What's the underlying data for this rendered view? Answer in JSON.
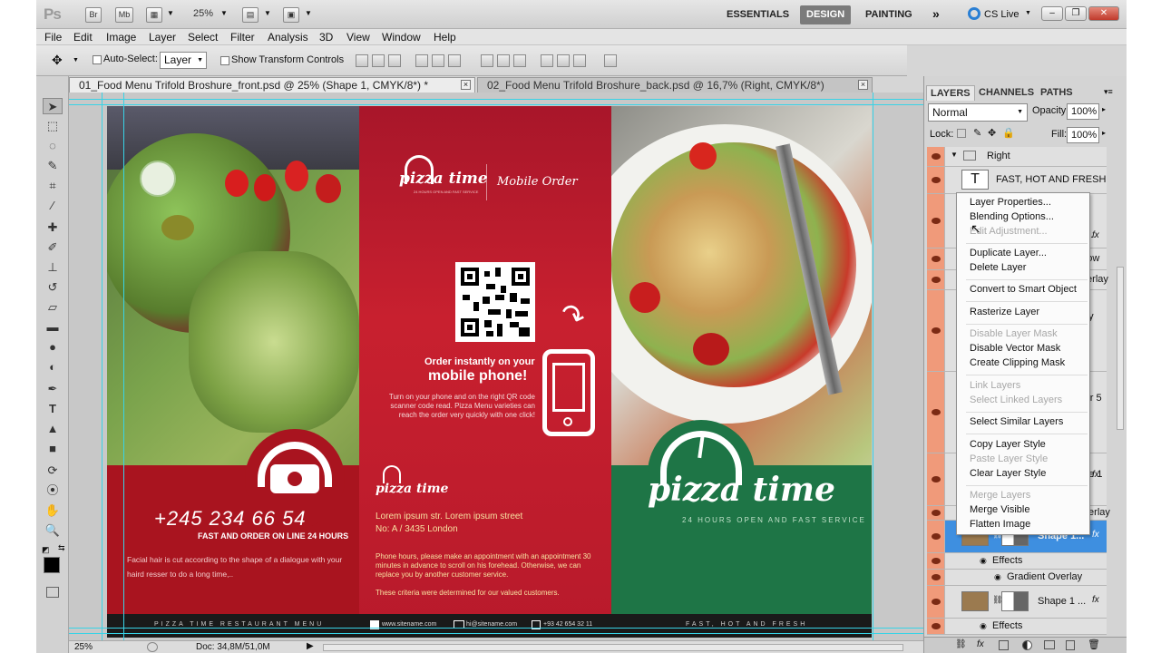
{
  "app_bar": {
    "logo": "Ps",
    "bridge_btn": "Br",
    "mini_bridge_btn": "Mb",
    "zoom": "25%",
    "workspaces": [
      "ESSENTIALS",
      "DESIGN",
      "PAINTING"
    ],
    "active_workspace": "DESIGN",
    "more": "»",
    "cs_live": "CS Live",
    "window_buttons": [
      "–",
      "❐",
      "✕"
    ]
  },
  "menu": [
    "File",
    "Edit",
    "Image",
    "Layer",
    "Select",
    "Filter",
    "Analysis",
    "3D",
    "View",
    "Window",
    "Help"
  ],
  "options": {
    "auto_select_label": "Auto-Select:",
    "auto_select_value": "Layer",
    "show_transform_label": "Show Transform Controls"
  },
  "tabs": [
    {
      "label": "01_Food Menu Trifold Broshure_front.psd @ 25% (Shape 1, CMYK/8*) *",
      "close": "×"
    },
    {
      "label": "02_Food Menu Trifold Broshure_back.psd @ 16,7% (Right, CMYK/8*)",
      "close": "×"
    }
  ],
  "brochure": {
    "panel1": {
      "phone": "+245 234 66 54",
      "subtitle": "FAST AND ORDER ON LINE 24 HOURS",
      "body": "Facial hair is cut according to the shape of a dialogue with your haird resser to do a long time,..",
      "footer": "PIZZA TIME RESTAURANT MENU"
    },
    "panel2": {
      "brand": "pizza time",
      "brand_tag": "24 HOURS OPEN AND FAST SERVICE",
      "mobile_order": "Mobile Order",
      "order_line1": "Order instantly on your",
      "order_line2": "mobile phone!",
      "order_body": "Turn on your phone and on the right QR code scanner code read. Pizza Menu varieties can reach the order very quickly with one click!",
      "address_line1": "Lorem ipsum str. Lorem ipsum street",
      "address_line2": "No: A / 3435 London",
      "hours": "Phone hours, please make an appointment with an appointment 30 minutes in advance to scroll on his forehead. Otherwise, we can replace you by another customer service.",
      "criteria": "These criteria were determined for our valued customers.",
      "site": "www.sitename.com",
      "email": "hi@sitename.com",
      "phone_footer": "+93 42 654 32 11"
    },
    "panel3": {
      "brand": "pizza time",
      "tagline": "24 HOURS OPEN AND FAST SERVICE",
      "footer": "FAST, HOT AND FRESH"
    }
  },
  "status": {
    "zoom": "25%",
    "doc": "Doc: 34,8M/51,0M"
  },
  "layers_panel": {
    "tabs": [
      "LAYERS",
      "CHANNELS",
      "PATHS"
    ],
    "blend_mode": "Normal",
    "opacity_label": "Opacity:",
    "opacity": "100%",
    "lock_label": "Lock:",
    "fill_label": "Fill:",
    "fill": "100%",
    "group_name": "Right",
    "text_layer": "FAST, HOT AND FRESH",
    "partial": [
      "OPE...",
      "adow",
      "Overlay",
      "py",
      "ayer 5",
      "ape 1",
      "Overlay"
    ],
    "selected_layer": "Shape 1...",
    "effects": "Effects",
    "gradient_overlay": "Gradient Overlay",
    "shape_copy": "Shape 1 ...",
    "effects2": "Effects",
    "fx": "fx"
  },
  "context_menu": [
    {
      "label": "Layer Properties...",
      "enabled": true
    },
    {
      "label": "Blending Options...",
      "enabled": true
    },
    {
      "label": "Edit Adjustment...",
      "enabled": false
    },
    {
      "label": "Duplicate Layer...",
      "enabled": true
    },
    {
      "label": "Delete Layer",
      "enabled": true
    },
    {
      "label": "Convert to Smart Object",
      "enabled": true
    },
    {
      "label": "Rasterize Layer",
      "enabled": true
    },
    {
      "label": "Disable Layer Mask",
      "enabled": false
    },
    {
      "label": "Disable Vector Mask",
      "enabled": true
    },
    {
      "label": "Create Clipping Mask",
      "enabled": true
    },
    {
      "label": "Link Layers",
      "enabled": false
    },
    {
      "label": "Select Linked Layers",
      "enabled": false
    },
    {
      "label": "Select Similar Layers",
      "enabled": true
    },
    {
      "label": "Copy Layer Style",
      "enabled": true
    },
    {
      "label": "Paste Layer Style",
      "enabled": false
    },
    {
      "label": "Clear Layer Style",
      "enabled": true
    },
    {
      "label": "Merge Layers",
      "enabled": false
    },
    {
      "label": "Merge Visible",
      "enabled": true
    },
    {
      "label": "Flatten Image",
      "enabled": true
    }
  ],
  "colors": {
    "brand_red": "#c41f2e",
    "brand_green": "#1f7a4a",
    "dark_footer": "#1a1a1a",
    "highlight": "#3e8fe0"
  }
}
